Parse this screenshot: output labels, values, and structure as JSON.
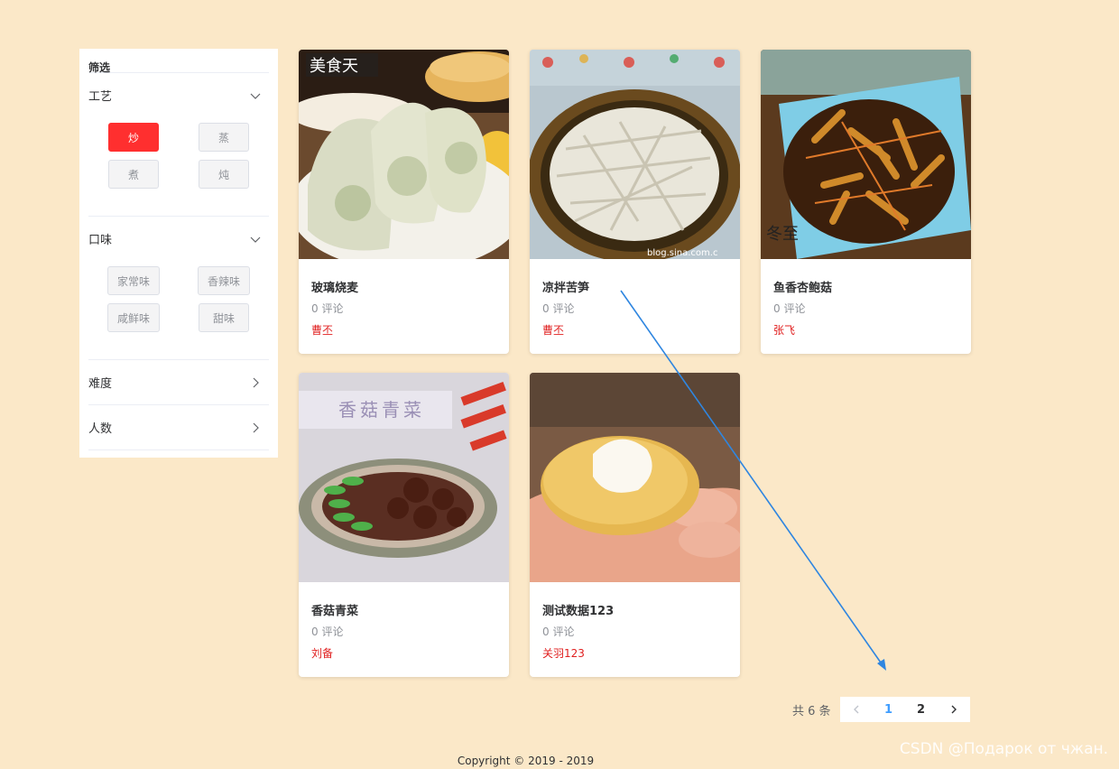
{
  "sidebar": {
    "title": "筛选",
    "sections": [
      {
        "label": "工艺",
        "expanded": true,
        "options": [
          "炒",
          "蒸",
          "煮",
          "炖"
        ],
        "selected": "炒"
      },
      {
        "label": "口味",
        "expanded": true,
        "options": [
          "家常味",
          "香辣味",
          "咸鲜味",
          "甜味"
        ],
        "selected": null
      },
      {
        "label": "难度",
        "expanded": false
      },
      {
        "label": "人数",
        "expanded": false
      }
    ]
  },
  "recipes": [
    {
      "title": "玻璃烧麦",
      "comments": "0 评论",
      "author": "曹丕",
      "image": "dumplings-photo"
    },
    {
      "title": "凉拌苦笋",
      "comments": "0 评论",
      "author": "曹丕",
      "image": "bamboo-shoots-photo"
    },
    {
      "title": "鱼香杏鲍菇",
      "comments": "0 评论",
      "author": "张飞",
      "image": "mushroom-stirfry-photo"
    },
    {
      "title": "香菇青菜",
      "comments": "0 评论",
      "author": "刘备",
      "image": "mushroom-greens-photo"
    },
    {
      "title": "测试数据123",
      "comments": "0 评论",
      "author": "关羽123",
      "image": "cream-puff-photo"
    }
  ],
  "pagination": {
    "total_label": "共 6 条",
    "pages": [
      "1",
      "2"
    ],
    "current": "1"
  },
  "footer": {
    "copyright": "Copyright © 2019 - 2019"
  },
  "watermark": "CSDN @Подарок от чжан.",
  "image_text": {
    "dumplings_logo": "美食天",
    "mushroom_banner": "香菇青菜",
    "blog_url": "blog.sina.com.c",
    "seal": "冬至"
  },
  "colors": {
    "background": "#fbe8c8",
    "accent_red": "#ff2f2f",
    "author_red": "#e02020",
    "page_active": "#409eff",
    "annotation_arrow": "#2f86e0"
  }
}
